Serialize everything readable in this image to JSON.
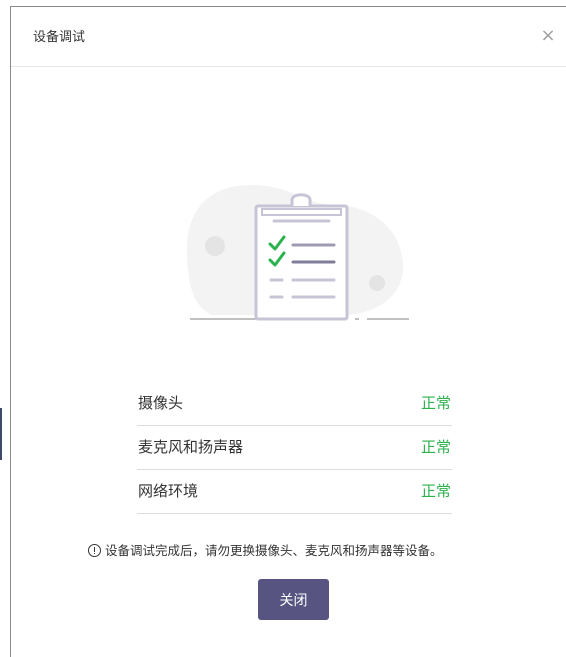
{
  "dialog": {
    "title": "设备调试",
    "close_icon": "×"
  },
  "illustration": {
    "icon": "clipboard-checklist-icon"
  },
  "status_items": [
    {
      "label": "摄像头",
      "status": "正常"
    },
    {
      "label": "麦克风和扬声器",
      "status": "正常"
    },
    {
      "label": "网络环境",
      "status": "正常"
    }
  ],
  "notice": {
    "icon": "info-circle-icon",
    "text": "设备调试完成后，请勿更换摄像头、麦克风和扬声器等设备。"
  },
  "actions": {
    "close_label": "关闭"
  },
  "colors": {
    "accent": "#575482",
    "status_ok": "#2bb24c",
    "text": "#333333",
    "divider": "#dcdcdc"
  }
}
